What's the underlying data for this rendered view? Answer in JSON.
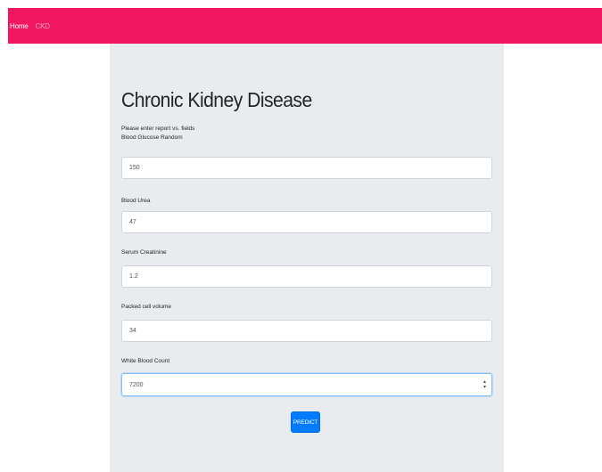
{
  "navbar": {
    "home_label": "Home",
    "secondary_label": "CKD",
    "bg_color": "#f2155f"
  },
  "form": {
    "title": "Chronic Kidney Disease",
    "subtitle": "Please enter report vs. fields",
    "fields": [
      {
        "label": "Blood Glucose Random",
        "value": "150"
      },
      {
        "label": "Blood Urea",
        "value": "47"
      },
      {
        "label": "Serum Creatinine",
        "value": "1.2"
      },
      {
        "label": "Packed cell volume",
        "value": "34"
      },
      {
        "label": "White Blood Count",
        "value": "7200"
      }
    ],
    "submit_label": "PREDICT",
    "accent_color": "#007bff"
  }
}
